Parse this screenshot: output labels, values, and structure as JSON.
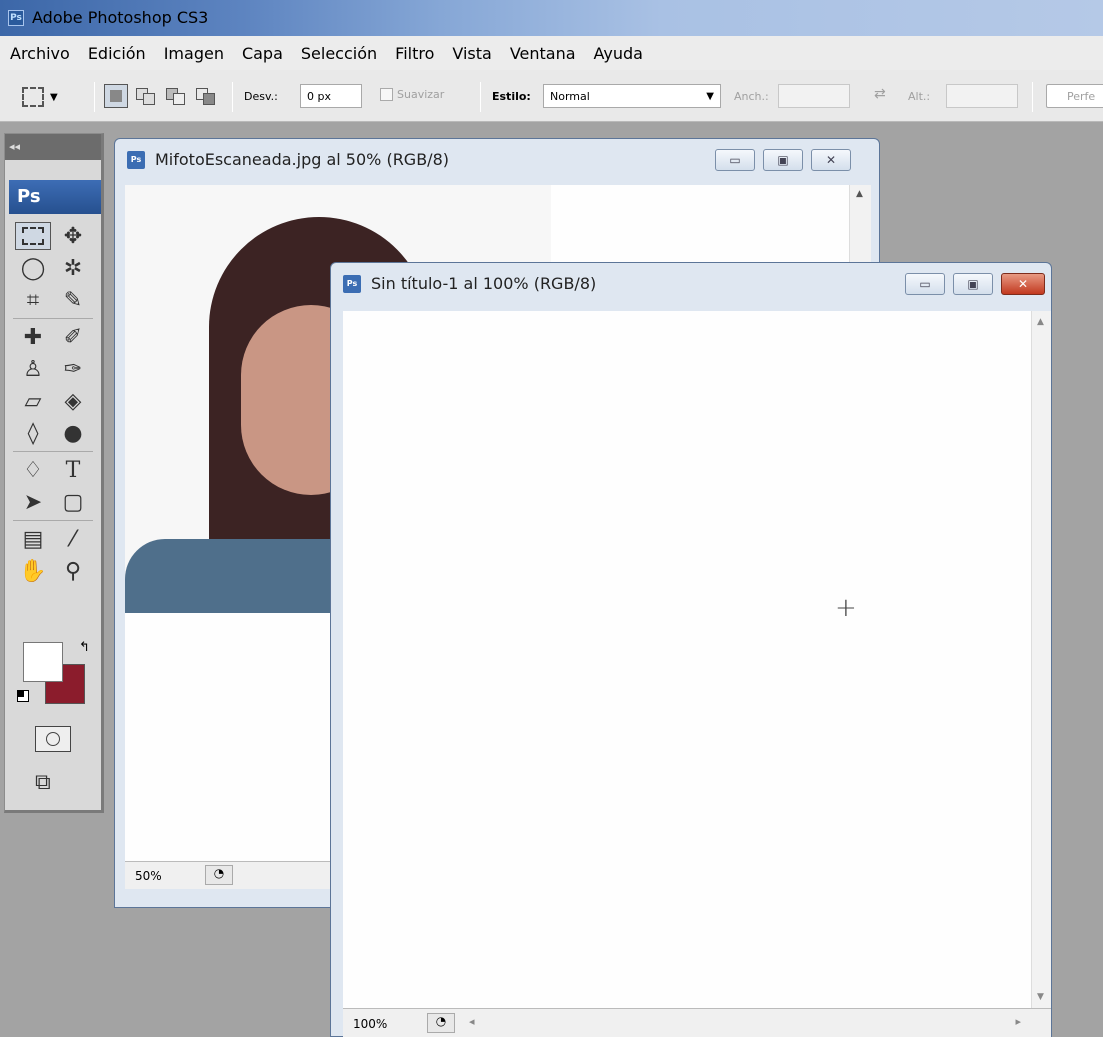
{
  "app": {
    "title": "Adobe Photoshop CS3",
    "icon_text": "Ps"
  },
  "menu": [
    "Archivo",
    "Edición",
    "Imagen",
    "Capa",
    "Selección",
    "Filtro",
    "Vista",
    "Ventana",
    "Ayuda"
  ],
  "options": {
    "desv_label": "Desv.:",
    "desv_value": "0 px",
    "suavizar_label": "Suavizar",
    "estilo_label": "Estilo:",
    "estilo_value": "Normal",
    "anch_label": "Anch.:",
    "alt_label": "Alt.:",
    "perfil_label": "Perfe"
  },
  "tool_panel": {
    "header": "Ps",
    "collapse": "◂◂"
  },
  "colors": {
    "foreground": "#ffffff",
    "background": "#8b1c2c"
  },
  "window_back": {
    "title": "MifotoEscaneada.jpg al 50% (RGB/8)",
    "zoom": "50%",
    "icon_text": "Ps"
  },
  "window_front": {
    "title": "Sin título-1 al 100% (RGB/8)",
    "zoom": "100%",
    "icon_text": "Ps"
  }
}
